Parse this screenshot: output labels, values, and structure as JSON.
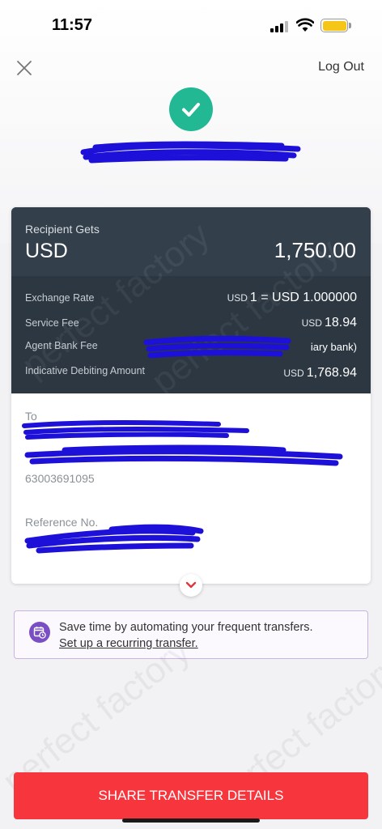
{
  "status_bar": {
    "time": "11:57"
  },
  "header": {
    "logout_label": "Log Out"
  },
  "summary": {
    "recipient_gets_label": "Recipient Gets",
    "currency": "USD",
    "amount": "1,750.00",
    "rows": [
      {
        "label": "Exchange Rate",
        "prefix": "USD",
        "value": "1 = USD 1.000000"
      },
      {
        "label": "Service Fee",
        "prefix": "USD",
        "value": "18.94"
      },
      {
        "label": "Agent Bank Fee",
        "prefix": "",
        "value": "iary bank)"
      },
      {
        "label": "Indicative Debiting Amount",
        "prefix": "USD",
        "value": "1,768.94"
      }
    ]
  },
  "details": {
    "to_label": "To",
    "account_number": "63003691095",
    "reference_label": "Reference No."
  },
  "banner": {
    "text": "Save time by automating your frequent transfers.",
    "link": "Set up a recurring transfer."
  },
  "share_button": "SHARE TRANSFER DETAILS",
  "colors": {
    "success": "#22b893",
    "accent": "#f7353d",
    "banner_icon": "#7b4fc4",
    "card_dark": "#2c3741"
  },
  "icons": [
    "close-icon",
    "checkmark-icon",
    "chevron-down-icon",
    "calendar-clock-icon"
  ]
}
